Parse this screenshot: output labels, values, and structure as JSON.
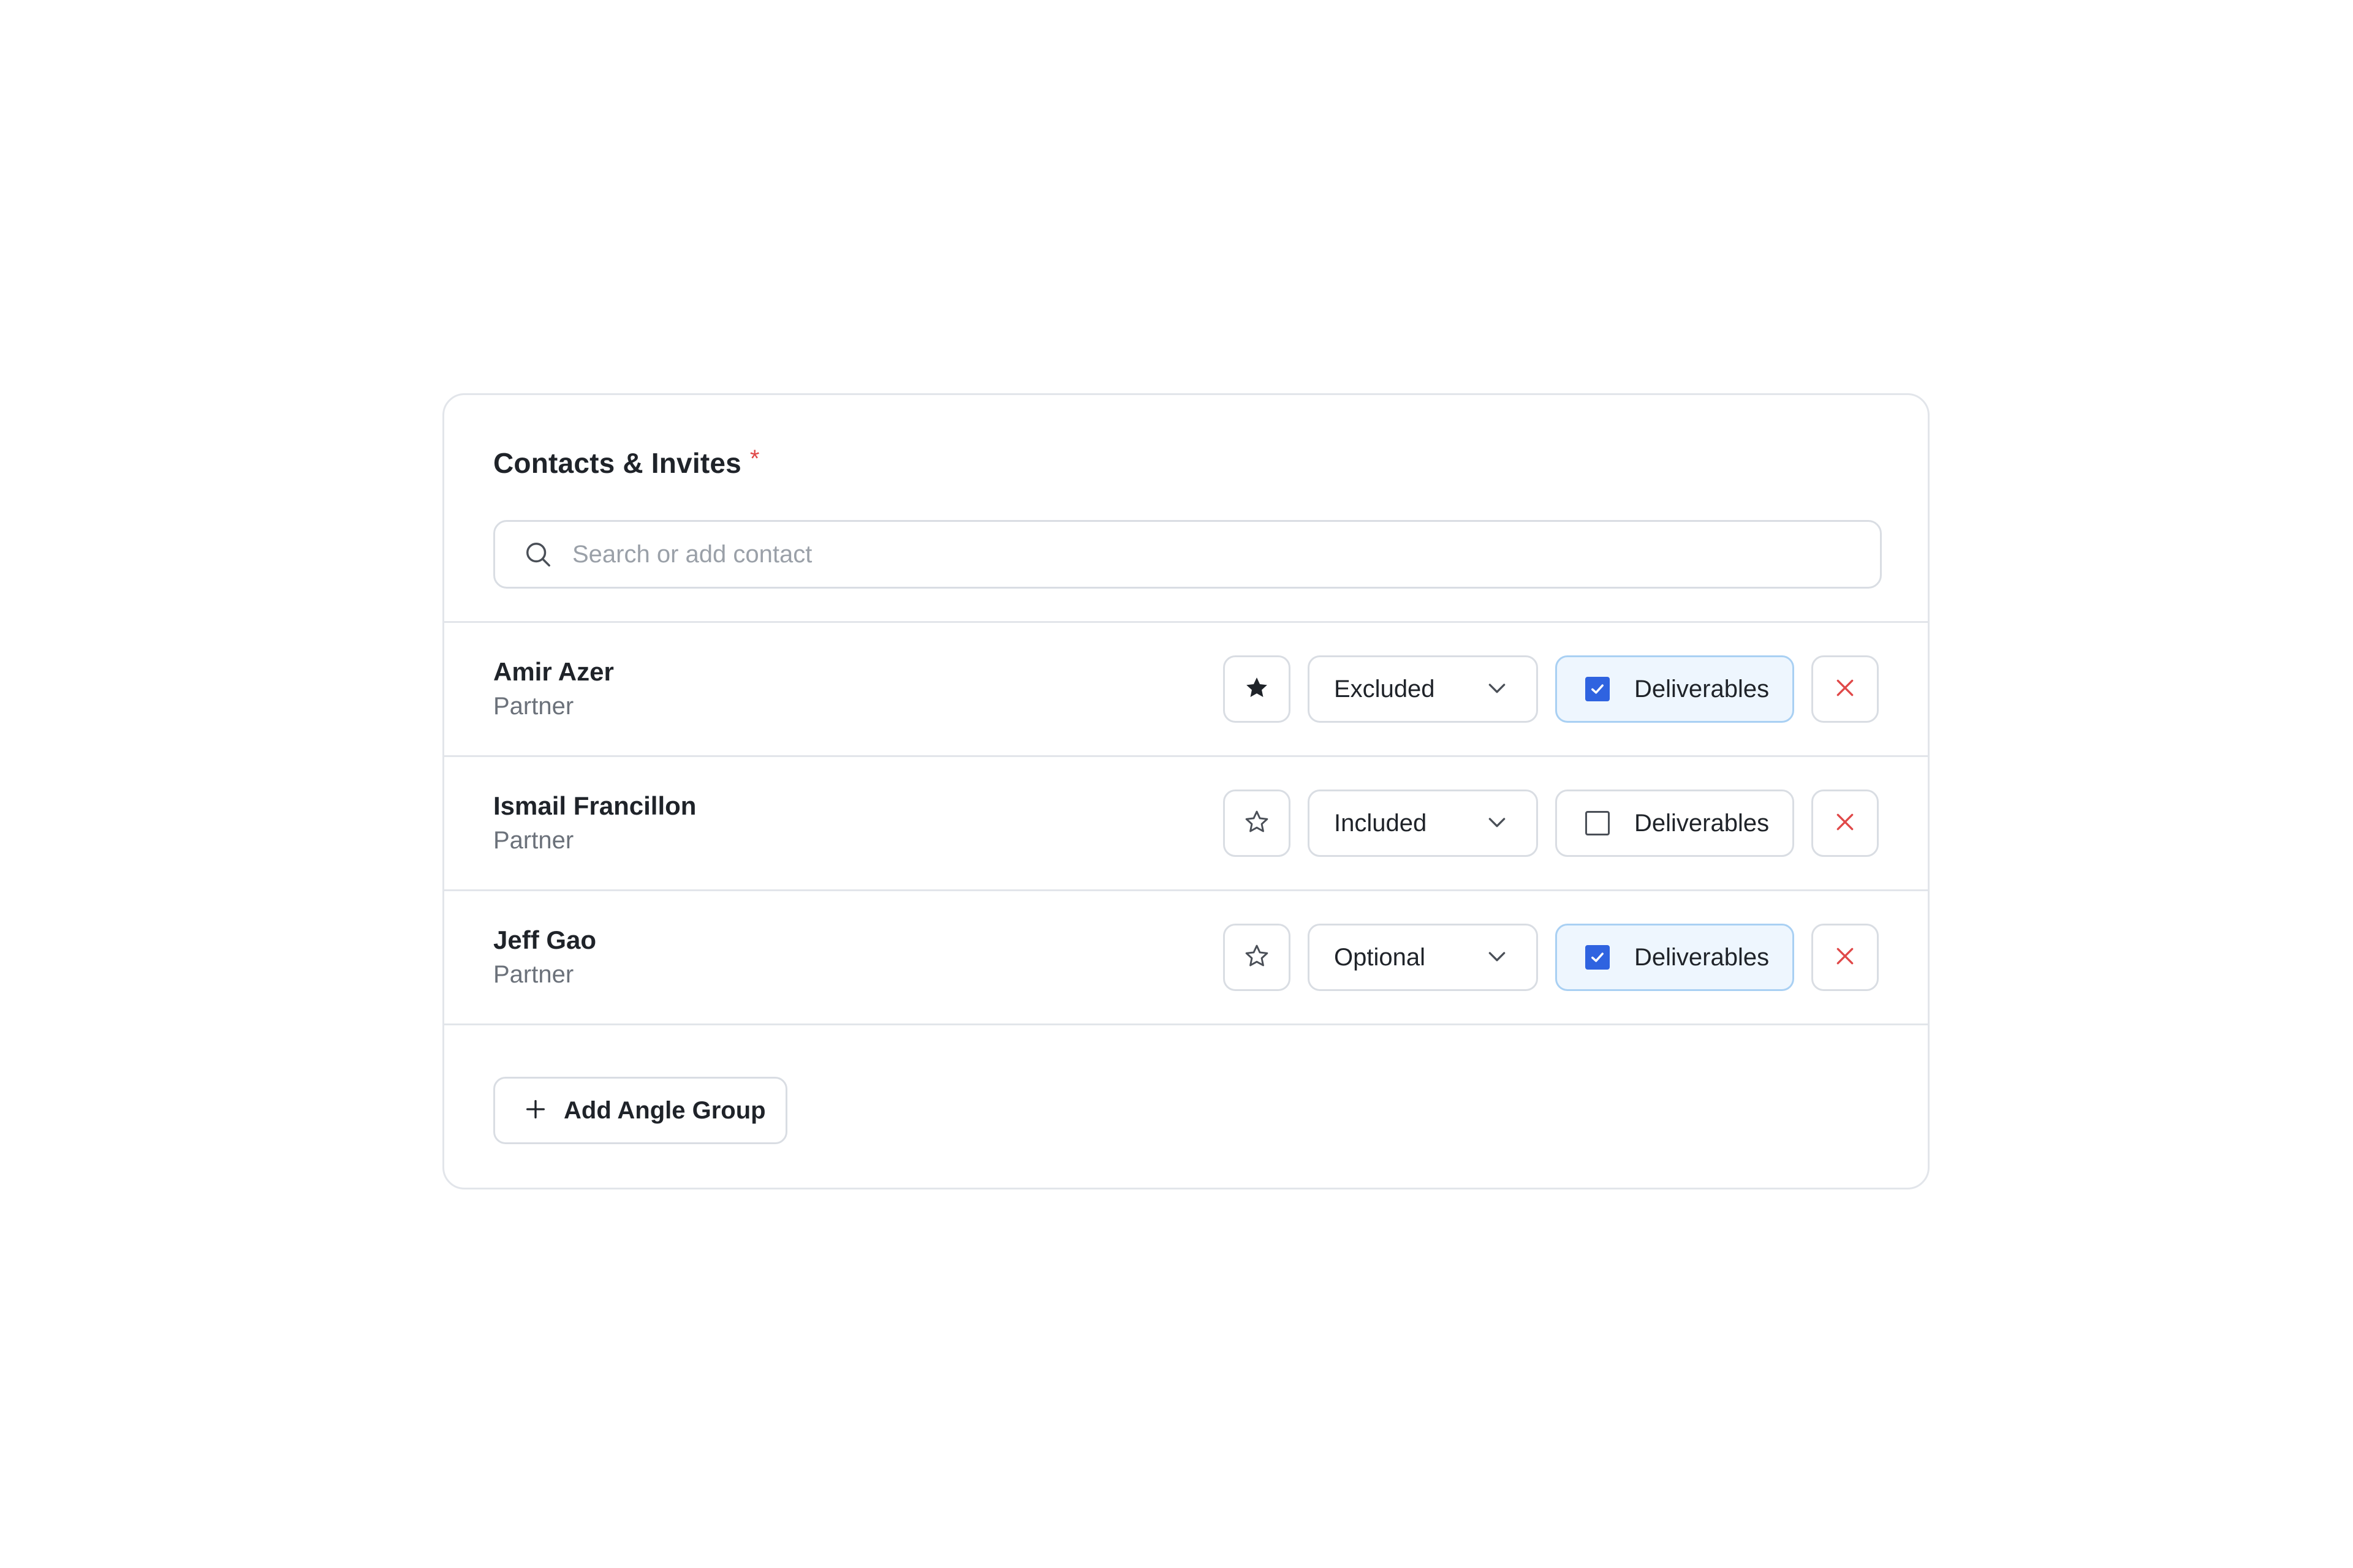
{
  "header": {
    "title": "Contacts & Invites",
    "required_marker": "*"
  },
  "search": {
    "icon": "search-icon",
    "placeholder": "Search or add contact",
    "value": ""
  },
  "contacts": [
    {
      "name": "Amir Azer",
      "role": "Partner",
      "starred": true,
      "status": "Excluded",
      "deliverables_label": "Deliverables",
      "deliverables_checked": true
    },
    {
      "name": "Ismail Francillon",
      "role": "Partner",
      "starred": false,
      "status": "Included",
      "deliverables_label": "Deliverables",
      "deliverables_checked": false
    },
    {
      "name": "Jeff Gao",
      "role": "Partner",
      "starred": false,
      "status": "Optional",
      "deliverables_label": "Deliverables",
      "deliverables_checked": true
    }
  ],
  "footer": {
    "add_group_label": "Add Angle Group",
    "add_icon": "plus-icon"
  },
  "colors": {
    "accent": "#2f63e0",
    "required": "#e04848",
    "remove": "#e04848",
    "checked_bg": "#eef6fe",
    "checked_border": "#a9d0f3",
    "border": "#d9dde3"
  }
}
